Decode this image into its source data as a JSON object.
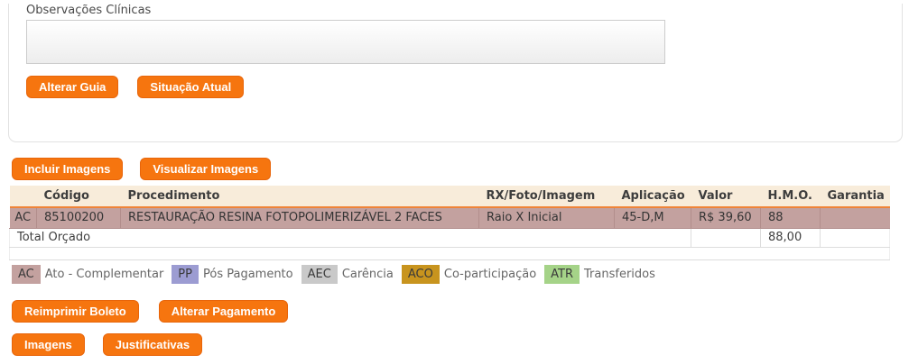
{
  "card": {
    "observations_label": "Observações Clínicas",
    "observations_value": "",
    "buttons": [
      {
        "label": "Alterar Guia"
      },
      {
        "label": "Situação Atual"
      }
    ]
  },
  "image_buttons": [
    {
      "label": "Incluir Imagens"
    },
    {
      "label": "Visualizar Imagens"
    }
  ],
  "procedures_table": {
    "headers": [
      "",
      "Código",
      "Procedimento",
      "RX/Foto/Imagem",
      "Aplicação",
      "Valor",
      "H.M.O.",
      "Garantia"
    ],
    "rows": [
      {
        "tag": "AC",
        "codigo": "85100200",
        "procedimento": "RESTAURAÇÃO RESINA FOTOPOLIMERIZÁVEL 2 FACES",
        "rx_foto_imagem": "Raio X Inicial",
        "aplicacao": "45-D,M",
        "valor": "R$ 39,60",
        "hmo": "88",
        "garantia": ""
      }
    ],
    "total": {
      "label": "Total Orçado",
      "valor": "",
      "hmo": "88,00",
      "garantia": ""
    }
  },
  "legend": [
    {
      "code": "AC",
      "label": "Ato - Complementar",
      "color": "#c3a19f"
    },
    {
      "code": "PP",
      "label": "Pós Pagamento",
      "color": "#9c9cd2"
    },
    {
      "code": "AEC",
      "label": "Carência",
      "color": "#c9c9c9"
    },
    {
      "code": "ACO",
      "label": "Co-participação",
      "color": "#c8941e"
    },
    {
      "code": "ATR",
      "label": "Transferidos",
      "color": "#a5d388"
    }
  ],
  "payment_buttons": [
    {
      "label": "Reimprimir Boleto"
    },
    {
      "label": "Alterar Pagamento"
    }
  ],
  "bottom_buttons": [
    {
      "label": "Imagens"
    },
    {
      "label": "Justificativas"
    }
  ],
  "colors": {
    "accent_orange": "#f6750f",
    "table_header_bg": "#f8ecda",
    "table_header_underline": "#ef8438",
    "row_highlight": "#c3a19f"
  }
}
